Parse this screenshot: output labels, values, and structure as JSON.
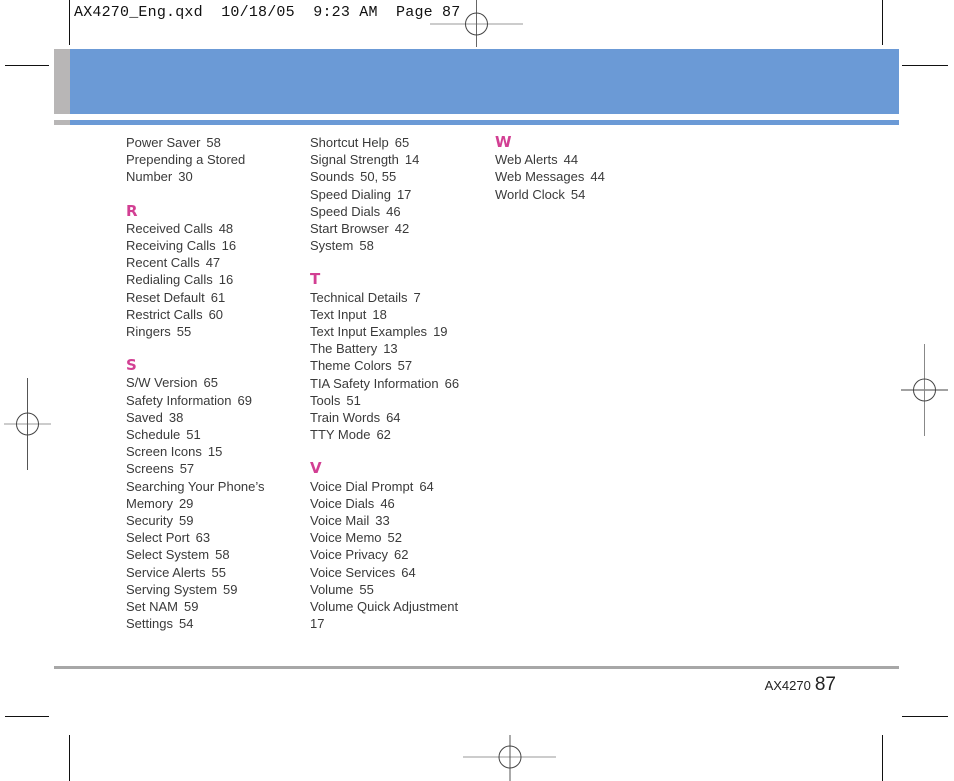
{
  "slug": "AX4270_Eng.qxd  10/18/05  9:23 AM  Page 87",
  "colors": {
    "header_blue": "#6b9ad6",
    "header_gray": "#b8b6b6",
    "section_letter": "#d23f93",
    "footer_rule": "#a7a7a7"
  },
  "columns": [
    {
      "sections": [
        {
          "letter": "",
          "entries": [
            {
              "term": "Power Saver",
              "pages": "58"
            },
            {
              "term": "Prepending a Stored",
              "pages": ""
            },
            {
              "term": "Number",
              "pages": "30"
            }
          ]
        },
        {
          "letter": "R",
          "entries": [
            {
              "term": "Received Calls",
              "pages": "48"
            },
            {
              "term": "Receiving Calls",
              "pages": "16"
            },
            {
              "term": "Recent Calls",
              "pages": "47"
            },
            {
              "term": "Redialing Calls",
              "pages": "16"
            },
            {
              "term": "Reset Default",
              "pages": "61"
            },
            {
              "term": "Restrict Calls",
              "pages": "60"
            },
            {
              "term": "Ringers",
              "pages": "55"
            }
          ]
        },
        {
          "letter": "S",
          "entries": [
            {
              "term": "S/W Version",
              "pages": "65"
            },
            {
              "term": "Safety Information",
              "pages": "69"
            },
            {
              "term": "Saved",
              "pages": "38"
            },
            {
              "term": "Schedule",
              "pages": "51"
            },
            {
              "term": "Screen Icons",
              "pages": "15"
            },
            {
              "term": "Screens",
              "pages": "57"
            },
            {
              "term": "Searching Your Phone’s",
              "pages": ""
            },
            {
              "term": "Memory",
              "pages": "29"
            },
            {
              "term": "Security",
              "pages": "59"
            },
            {
              "term": "Select Port",
              "pages": "63"
            },
            {
              "term": "Select System",
              "pages": "58"
            },
            {
              "term": "Service Alerts",
              "pages": "55"
            },
            {
              "term": "Serving System",
              "pages": "59"
            },
            {
              "term": "Set NAM",
              "pages": "59"
            },
            {
              "term": "Settings",
              "pages": "54"
            }
          ]
        }
      ]
    },
    {
      "sections": [
        {
          "letter": "",
          "entries": [
            {
              "term": "Shortcut Help",
              "pages": "65"
            },
            {
              "term": "Signal Strength",
              "pages": "14"
            },
            {
              "term": "Sounds",
              "pages": "50, 55"
            },
            {
              "term": "Speed Dialing",
              "pages": "17"
            },
            {
              "term": "Speed Dials",
              "pages": "46"
            },
            {
              "term": "Start Browser",
              "pages": "42"
            },
            {
              "term": "System",
              "pages": "58"
            }
          ]
        },
        {
          "letter": "T",
          "entries": [
            {
              "term": "Technical Details",
              "pages": "7"
            },
            {
              "term": "Text Input",
              "pages": "18"
            },
            {
              "term": "Text Input Examples",
              "pages": "19"
            },
            {
              "term": "The Battery",
              "pages": "13"
            },
            {
              "term": "Theme Colors",
              "pages": "57"
            },
            {
              "term": "TIA Safety Information",
              "pages": "66"
            },
            {
              "term": "Tools",
              "pages": "51"
            },
            {
              "term": "Train Words",
              "pages": "64"
            },
            {
              "term": "TTY Mode",
              "pages": "62"
            }
          ]
        },
        {
          "letter": "V",
          "entries": [
            {
              "term": "Voice Dial Prompt",
              "pages": "64"
            },
            {
              "term": "Voice Dials",
              "pages": "46"
            },
            {
              "term": "Voice Mail",
              "pages": "33"
            },
            {
              "term": "Voice Memo",
              "pages": "52"
            },
            {
              "term": "Voice Privacy",
              "pages": "62"
            },
            {
              "term": "Voice Services",
              "pages": "64"
            },
            {
              "term": "Volume",
              "pages": "55"
            },
            {
              "term": "Volume Quick Adjustment",
              "pages": ""
            },
            {
              "term": "17",
              "pages": ""
            }
          ]
        }
      ]
    },
    {
      "sections": [
        {
          "letter": "W",
          "entries": [
            {
              "term": "Web Alerts",
              "pages": "44"
            },
            {
              "term": "Web Messages",
              "pages": "44"
            },
            {
              "term": "World Clock",
              "pages": "54"
            }
          ]
        }
      ]
    }
  ],
  "footer": {
    "model": "AX4270",
    "page_number": "87"
  }
}
